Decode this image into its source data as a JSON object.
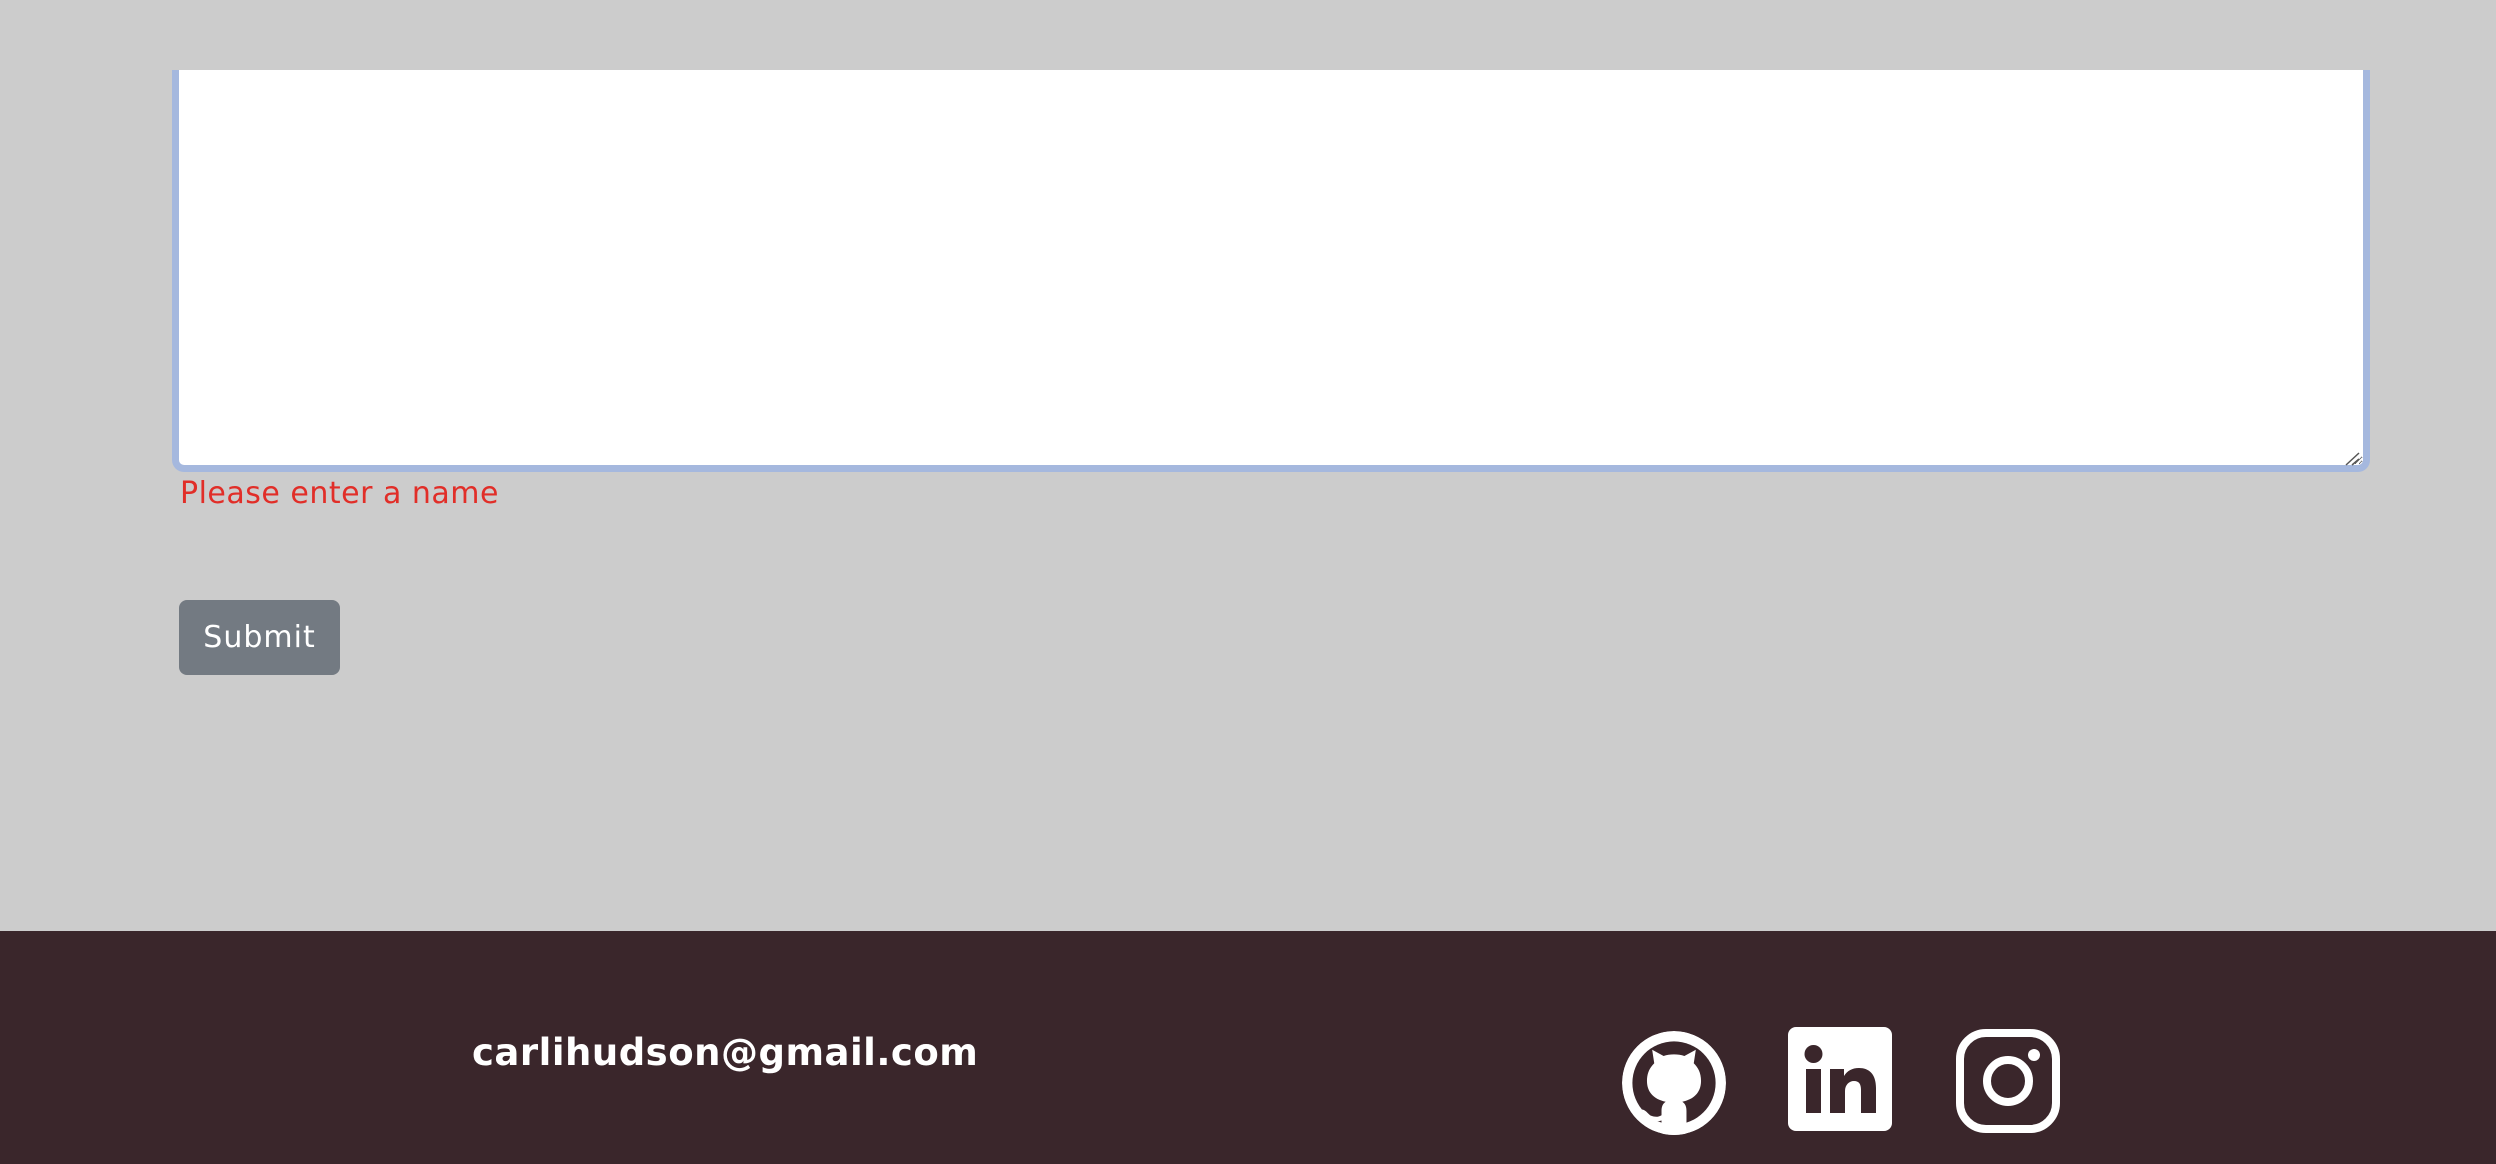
{
  "form": {
    "message_value": "",
    "error_message": "Please enter a name",
    "submit_label": "Submit"
  },
  "footer": {
    "email": "carlihudson@gmail.com",
    "social": [
      {
        "name": "github",
        "icon": "github-icon"
      },
      {
        "name": "linkedin",
        "icon": "linkedin-icon"
      },
      {
        "name": "instagram",
        "icon": "instagram-icon"
      }
    ]
  },
  "colors": {
    "page_background": "#cccccc",
    "focus_border": "#a5b8de",
    "error_text": "#e12e28",
    "button_background": "#737a82",
    "footer_background": "#3a262b",
    "footer_text": "#ffffff"
  }
}
